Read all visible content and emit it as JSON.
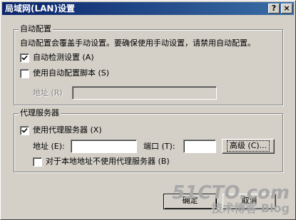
{
  "window": {
    "title": "局域网(LAN)设置",
    "help_label": "?",
    "close_label": "×"
  },
  "auto_config": {
    "legend": "自动配置",
    "description": "自动配置会覆盖手动设置。要确保使用手动设置，请禁用自动配置。",
    "auto_detect": {
      "label": "自动检测设置 (A)",
      "checked": true
    },
    "use_script": {
      "label": "使用自动配置脚本 (S)",
      "checked": false
    },
    "address_label": "地址 (R)",
    "address_value": ""
  },
  "proxy": {
    "legend": "代理服务器",
    "use_proxy": {
      "label": "使用代理服务器 (X)",
      "checked": true
    },
    "address_label": "地址 (E):",
    "address_value": "",
    "port_label": "端口 (T):",
    "port_value": "",
    "advanced_label": "高级 (C)...",
    "bypass_local": {
      "label": "对于本地地址不使用代理服务器 (B)",
      "checked": false
    }
  },
  "footer": {
    "ok_label": "确定",
    "cancel_label": "取消"
  },
  "watermark": {
    "line1": "51CTO.com",
    "line2": "技术博客  Blog"
  },
  "colors": {
    "face": "#d4d0c8",
    "title_start": "#0a246a",
    "title_end": "#3a6ea5",
    "disabled_text": "#808080"
  }
}
